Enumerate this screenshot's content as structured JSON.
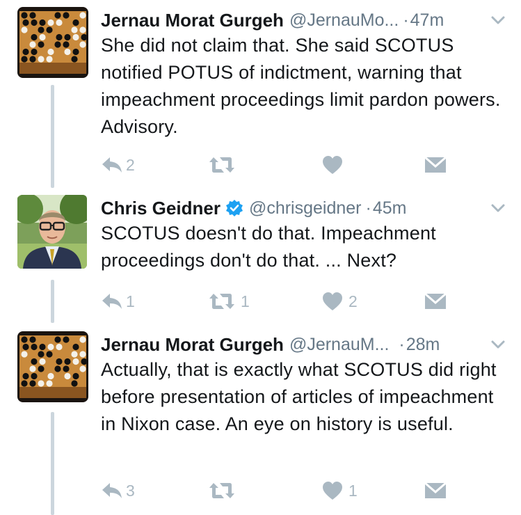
{
  "tweets": [
    {
      "name": "Jernau Morat Gurgeh",
      "handle": "@JernauMo...",
      "separator": "·",
      "time": "47m",
      "text": "She did not claim that. She said SCOTUS notified POTUS of indictment, warning that impeachment proceedings limit pardon powers. Advisory.",
      "reply_count": "2",
      "retweet_count": "",
      "like_count": "",
      "verified": false,
      "avatar": "go-board-avatar"
    },
    {
      "name": "Chris Geidner",
      "handle": "@chrisgeidner",
      "separator": "·",
      "time": "45m",
      "text": "SCOTUS doesn't do that. Impeachment proceedings don't do that. ... Next?",
      "reply_count": "1",
      "retweet_count": "1",
      "like_count": "2",
      "verified": true,
      "avatar": "person-photo-avatar"
    },
    {
      "name": "Jernau Morat Gurgeh",
      "handle": "@JernauM...",
      "separator": "·",
      "time": "28m",
      "text": "Actually, that is exactly what SCOTUS did right before presentation of articles of impeachment in Nixon case. An eye on history is useful.",
      "reply_count": "3",
      "retweet_count": "",
      "like_count": "1",
      "verified": false,
      "avatar": "go-board-avatar"
    }
  ],
  "colors": {
    "text": "#14171a",
    "secondary": "#657786",
    "icon": "#aab8c2",
    "verified": "#1da1f2",
    "thread_line": "#ccd6dd"
  },
  "icons": [
    "reply-icon",
    "retweet-icon",
    "like-icon",
    "direct-message-icon",
    "chevron-down-icon",
    "verified-badge-icon"
  ]
}
